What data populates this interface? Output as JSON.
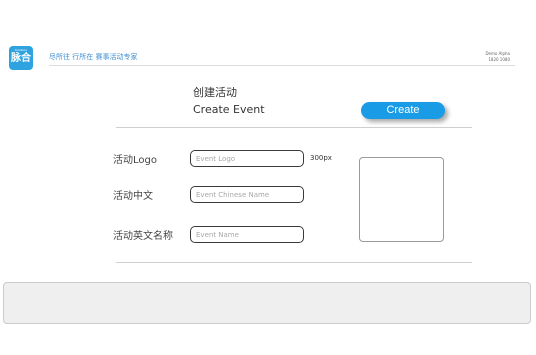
{
  "header": {
    "logo": {
      "small_text": "Kinoboo",
      "main_text": "脉合"
    },
    "slogan": "尽所往 行所在  赛事活动专家",
    "user": {
      "name": "Demo Alpha",
      "id": "1820 1080"
    }
  },
  "main": {
    "title_cn": "创建活动",
    "title_en": "Create Event",
    "create_button": "Create"
  },
  "form": {
    "logo_label": "活动Logo",
    "logo_placeholder": "Event Logo",
    "logo_size_hint": "300px",
    "cn_label": "活动中文",
    "cn_placeholder": "Event Chinese Name",
    "en_label": "活动英文名称",
    "en_placeholder": "Event Name"
  },
  "colors": {
    "accent": "#1a9be5",
    "logo_bg": "#2fa3e0",
    "slogan": "#3f8fd4"
  }
}
